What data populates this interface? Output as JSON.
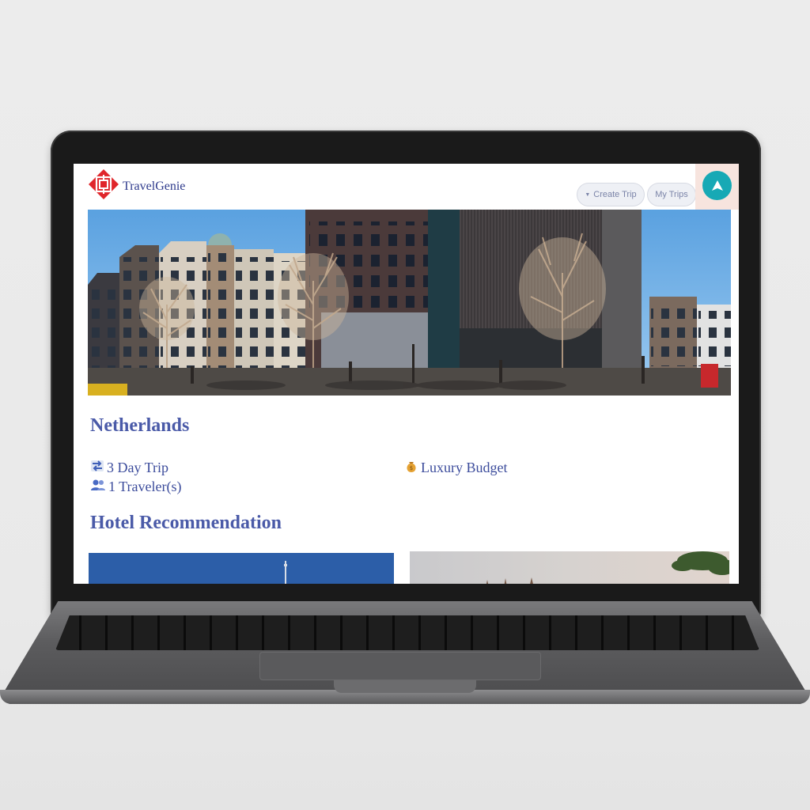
{
  "app": {
    "brand": "TravelGenie"
  },
  "nav": {
    "create_trip": "Create Trip",
    "my_trips": "My Trips"
  },
  "trip": {
    "destination": "Netherlands",
    "duration": "3 Day Trip",
    "travelers": "1 Traveler(s)",
    "budget": "Luxury Budget"
  },
  "sections": {
    "hotels": "Hotel Recommendation"
  },
  "colors": {
    "brand_text": "#2e3a8c",
    "heading": "#4a5aa8",
    "logo_red": "#e0262b",
    "nav_teal": "#17a9b5"
  },
  "icons": {
    "duration": "arrows-exchange-icon",
    "travelers": "people-icon",
    "budget": "money-bag-icon",
    "navigate": "navigation-arrow-icon"
  }
}
